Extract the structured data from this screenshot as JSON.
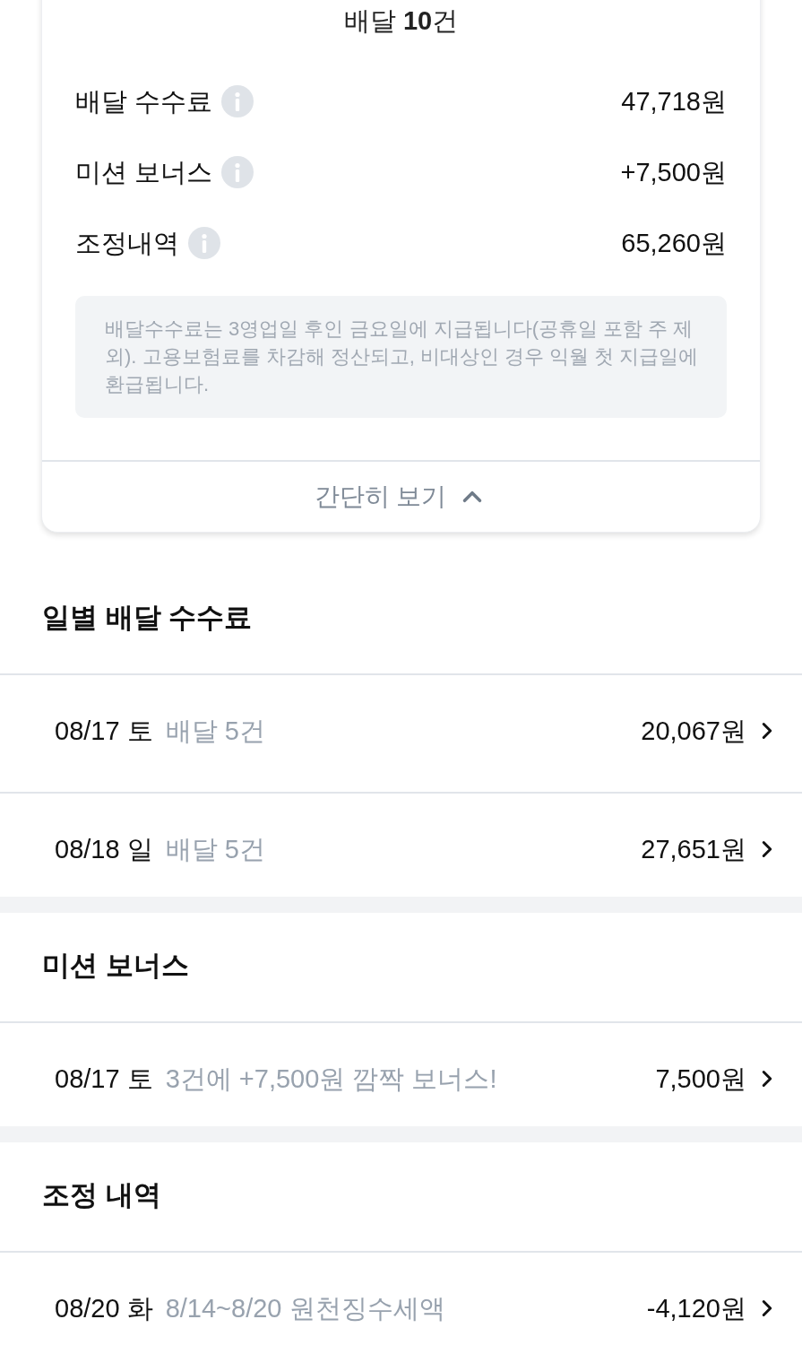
{
  "summary_card": {
    "title": "배달 **10**건",
    "items": [
      {
        "label": "배달 수수료",
        "amount": "47,718원"
      },
      {
        "label": "미션 보너스",
        "amount": "+7,500원"
      },
      {
        "label": "조정내역",
        "amount": "65,260원"
      }
    ],
    "note": "배달수수료는 3영업일 후인 금요일에 지급됩니다(공휴일 포함 주 제외). 고용보험료를 차감해 정산되고, 비대상인 경우 익월 첫 지급일에 환급됩니다.",
    "collapse_button": "간단히 보기"
  },
  "sections": [
    {
      "title": "일별 배달 수수료",
      "rows": [
        {
          "date": "08/17 토",
          "detail": "배달 5건",
          "amount": "20,067원"
        },
        {
          "date": "08/18 일",
          "detail": "배달 5건",
          "amount": "27,651원"
        }
      ]
    },
    {
      "title": "미션 보너스",
      "rows": [
        {
          "date": "08/17 토",
          "detail": "3건에 +7,500원 깜짝 보너스!",
          "amount": "7,500원"
        }
      ]
    },
    {
      "title": "조정 내역",
      "rows": [
        {
          "date": "08/20 화",
          "detail": "8/14~8/20 원천징수세액",
          "amount": "-4,120원"
        }
      ]
    }
  ]
}
